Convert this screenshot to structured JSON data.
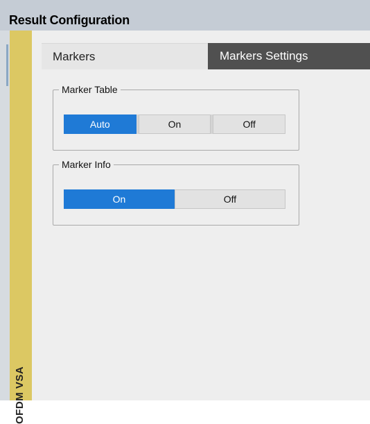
{
  "window": {
    "title": "Result Configuration"
  },
  "side_tab": {
    "label": "OFDM VSA"
  },
  "tabs": [
    {
      "label": "Markers",
      "selected": false
    },
    {
      "label": "Markers Settings",
      "selected": true
    }
  ],
  "marker_table": {
    "legend": "Marker Table",
    "options": [
      "Auto",
      "On",
      "Off"
    ],
    "selected": "Auto"
  },
  "marker_info": {
    "legend": "Marker Info",
    "options": [
      "On",
      "Off"
    ],
    "selected": "On"
  },
  "colors": {
    "accent": "#1f7ad6",
    "side_tab": "#dcc863",
    "active_tab": "#505050"
  }
}
